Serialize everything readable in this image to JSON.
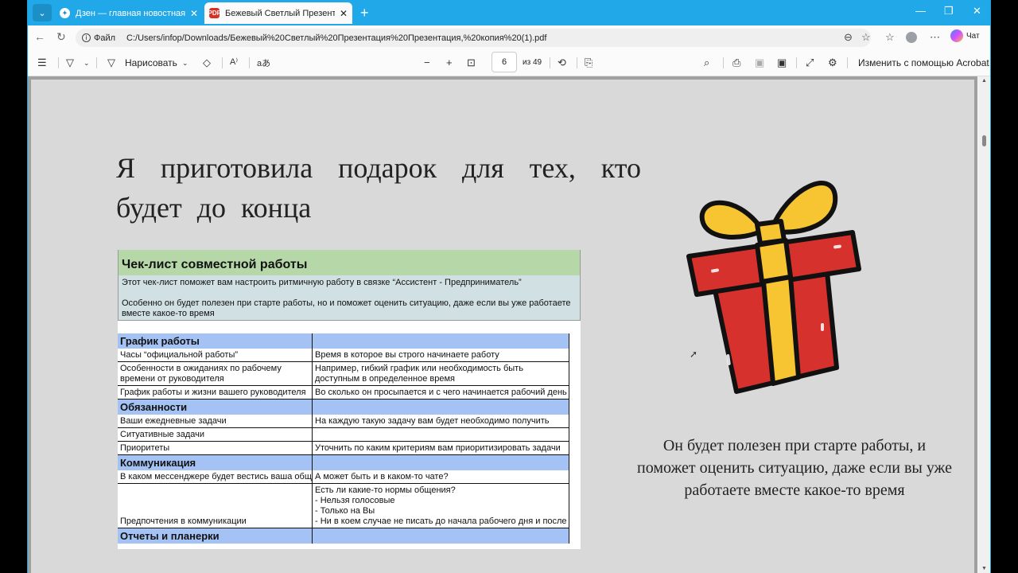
{
  "browser": {
    "tabs": [
      {
        "title": "Дзен — главная новостная инфо",
        "active": false
      },
      {
        "title": "Бежевый Светлый Презентация",
        "active": true
      }
    ],
    "url_scheme": "Файл",
    "url": "C:/Users/infop/Downloads/Бежевый%20Светлый%20Презентация%20Презентация,%20копия%20(1).pdf",
    "chat_label": "Чат"
  },
  "pdf_toolbar": {
    "draw_label": "Нарисовать",
    "page_current": "6",
    "page_total": "из 49",
    "edit_label": "Изменить с помощью Acrobat"
  },
  "slide": {
    "heading": "Я приготовила подарок для тех, кто будет до конца",
    "caption": "Он будет полезен при старте работы, и поможет оценить ситуацию, даже если вы уже работаете вместе какое-то время"
  },
  "sheet": {
    "title": "Чек-лист совместной работы",
    "intro_line1": "Этот чек-лист поможет вам настроить ритмичную работу в связке “Ассистент - Предприниматель”",
    "intro_line2": "Особенно он будет полезен при старте работы, но и поможет оценить ситуацию, даже если вы уже работаете вместе какое-то время",
    "rows": [
      {
        "type": "section",
        "c1": "График работы",
        "c2": ""
      },
      {
        "type": "data",
        "c1": "Часы “официальной работы”",
        "c2": "Время в которое вы строго начинаете работу"
      },
      {
        "type": "data",
        "c1": "Особенности в ожиданиях по рабочему\nвремени от руководителя",
        "c2": "Например, гибкий график или необходимость быть\nдоступным в определенное время"
      },
      {
        "type": "data",
        "c1": "График работы и жизни вашего руководителя",
        "c2": "Во сколько он просыпается и с чего начинается рабочий день"
      },
      {
        "type": "section",
        "c1": "Обязанности",
        "c2": ""
      },
      {
        "type": "data",
        "c1": "Ваши ежедневные задачи",
        "c2": "На каждую такую задачу вам будет необходимо получить"
      },
      {
        "type": "data",
        "c1": "Ситуативные задачи",
        "c2": ""
      },
      {
        "type": "data",
        "c1": "Приоритеты",
        "c2": "Уточнить по каким критериям вам приоритизировать задачи"
      },
      {
        "type": "section",
        "c1": "Коммуникация",
        "c2": ""
      },
      {
        "type": "data",
        "c1": "В каком мессенджере будет вестись ваша общение",
        "c2": "А может быть и в каком-то чате?"
      },
      {
        "type": "data",
        "c1": "\n\n\nПредпочтения в коммуникации",
        "c2": "Есть ли какие-то нормы общения?\n- Нельзя голосовые\n- Только на Вы\n- Ни в коем случае не писать до начала рабочего дня и после"
      },
      {
        "type": "section",
        "c1": "Отчеты и планерки",
        "c2": ""
      }
    ]
  },
  "colors": {
    "tab_strip": "#20a8e8",
    "sheet_title_bg": "#b6d7a8",
    "sheet_intro_bg": "#d0e0e3",
    "sheet_section_bg": "#a4c2f4",
    "gift_red": "#d7312e",
    "gift_yellow": "#f7c531"
  },
  "icons": [
    "tab-menu-icon",
    "dzen-favicon",
    "pdf-favicon",
    "close-icon",
    "new-tab-icon",
    "minimize-icon",
    "maximize-icon",
    "back-icon",
    "refresh-icon",
    "info-icon",
    "zoom-icon",
    "star-icon",
    "favorites-icon",
    "profile-icon",
    "more-icon",
    "copilot-icon",
    "contents-icon",
    "highlight-icon",
    "draw-icon",
    "eraser-icon",
    "read-aloud-icon",
    "translate-icon",
    "zoom-out-icon",
    "zoom-in-icon",
    "fit-page-icon",
    "rotate-icon",
    "page-view-icon",
    "search-icon",
    "print-icon",
    "save-icon",
    "save-as-icon",
    "fullscreen-icon",
    "settings-icon",
    "gift-icon",
    "cursor-icon"
  ]
}
